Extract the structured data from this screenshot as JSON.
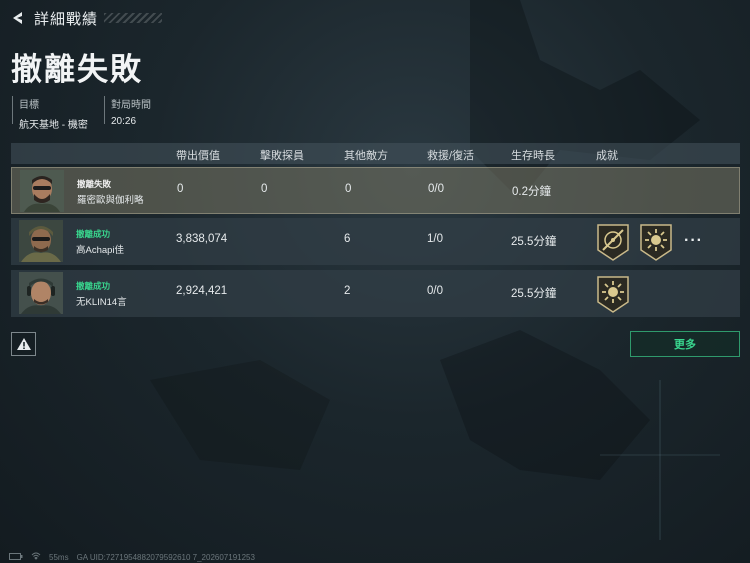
{
  "header": {
    "back_title": "詳細戰績"
  },
  "page_title": "撤離失敗",
  "info": {
    "target_label": "目標",
    "target_value": "航天基地 - 機密",
    "time_label": "對局時間",
    "time_value": "20:26"
  },
  "columns": [
    "帶出價值",
    "擊敗探員",
    "其他敵方",
    "救援/復活",
    "生存時長",
    "成就"
  ],
  "players": [
    {
      "status": "撤離失敗",
      "status_color": "#f0f0f0",
      "name": "羅密歐與伽利略",
      "value": "0",
      "kills": "0",
      "other": "0",
      "rescue": "0/0",
      "survival": "0.2分鐘",
      "badges": [],
      "has_more": false,
      "is_self": true
    },
    {
      "status": "撤離成功",
      "status_color": "#39d68e",
      "name": "高Achapi佳",
      "value": "3,838,074",
      "kills": "6",
      "other": "1/0",
      "rescue": "",
      "survival": "25.5分鐘",
      "badges": [
        "crosshair-badge-icon",
        "sunburst-badge-icon"
      ],
      "has_more": true,
      "is_self": false
    },
    {
      "status": "撤離成功",
      "status_color": "#39d68e",
      "name": "无KLIN14言",
      "value": "2,924,421",
      "kills": "2",
      "other": "0/0",
      "rescue": "",
      "survival": "25.5分鐘",
      "badges": [
        "sunburst-badge-icon"
      ],
      "has_more": false,
      "is_self": false
    }
  ],
  "more_dots": "···",
  "more_button": "更多",
  "footer": {
    "ping": "55ms",
    "uid": "GA UID:7271954882079592610 7_202607191253"
  },
  "colors": {
    "accent_green": "#39d68e",
    "self_row": "#7a7664"
  }
}
